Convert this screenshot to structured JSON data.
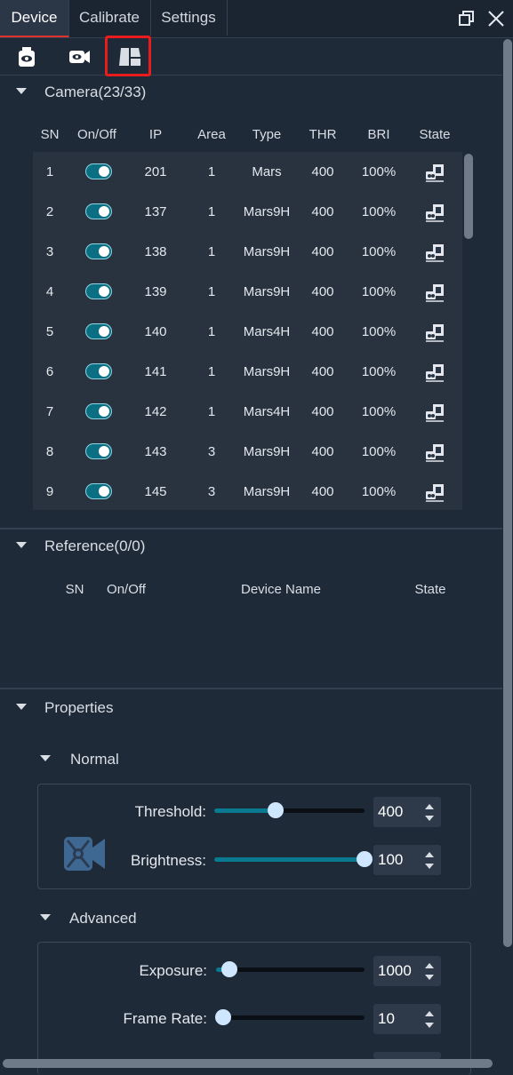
{
  "tabs": [
    {
      "label": "Device",
      "active": true
    },
    {
      "label": "Calibrate",
      "active": false
    },
    {
      "label": "Settings",
      "active": false
    }
  ],
  "toolbar_icons": [
    "device-view-icon",
    "camera-view-icon",
    "layout-view-icon"
  ],
  "camera": {
    "title": "Camera(23/33)",
    "headers": {
      "sn": "SN",
      "onoff": "On/Off",
      "ip": "IP",
      "area": "Area",
      "type": "Type",
      "thr": "THR",
      "bri": "BRI",
      "state": "State"
    },
    "rows": [
      {
        "sn": "1",
        "on": true,
        "ip": "201",
        "area": "1",
        "type": "Mars",
        "thr": "400",
        "bri": "100%"
      },
      {
        "sn": "2",
        "on": true,
        "ip": "137",
        "area": "1",
        "type": "Mars9H",
        "thr": "400",
        "bri": "100%"
      },
      {
        "sn": "3",
        "on": true,
        "ip": "138",
        "area": "1",
        "type": "Mars9H",
        "thr": "400",
        "bri": "100%"
      },
      {
        "sn": "4",
        "on": true,
        "ip": "139",
        "area": "1",
        "type": "Mars9H",
        "thr": "400",
        "bri": "100%"
      },
      {
        "sn": "5",
        "on": true,
        "ip": "140",
        "area": "1",
        "type": "Mars4H",
        "thr": "400",
        "bri": "100%"
      },
      {
        "sn": "6",
        "on": true,
        "ip": "141",
        "area": "1",
        "type": "Mars9H",
        "thr": "400",
        "bri": "100%"
      },
      {
        "sn": "7",
        "on": true,
        "ip": "142",
        "area": "1",
        "type": "Mars4H",
        "thr": "400",
        "bri": "100%"
      },
      {
        "sn": "8",
        "on": true,
        "ip": "143",
        "area": "3",
        "type": "Mars9H",
        "thr": "400",
        "bri": "100%"
      },
      {
        "sn": "9",
        "on": true,
        "ip": "145",
        "area": "3",
        "type": "Mars9H",
        "thr": "400",
        "bri": "100%"
      }
    ]
  },
  "reference": {
    "title": "Reference(0/0)",
    "headers": {
      "sn": "SN",
      "onoff": "On/Off",
      "name": "Device Name",
      "state": "State"
    }
  },
  "properties": {
    "title": "Properties",
    "normal": {
      "title": "Normal",
      "threshold": {
        "label": "Threshold:",
        "value": "400",
        "level": 0.41
      },
      "brightness": {
        "label": "Brightness:",
        "value": "100",
        "level": 1.0
      }
    },
    "advanced": {
      "title": "Advanced",
      "exposure": {
        "label": "Exposure:",
        "value": "1000",
        "level": 0.09
      },
      "framerate": {
        "label": "Frame Rate:",
        "value": "10",
        "level": 0.0
      }
    }
  },
  "colors": {
    "accent": "#0a7a91",
    "highlight": "#e81c1c",
    "active_tab_line": "#e0322f"
  }
}
